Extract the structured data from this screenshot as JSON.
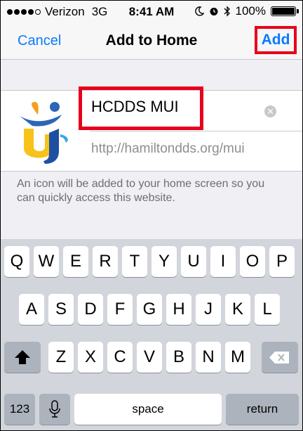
{
  "status_bar": {
    "carrier": "Verizon",
    "network": "3G",
    "time": "8:41 AM",
    "battery": "100%",
    "signal_bars_filled": 4,
    "signal_bars_total": 5,
    "battery_level": 1.0
  },
  "nav": {
    "cancel_label": "Cancel",
    "title": "Add to Home",
    "add_label": "Add"
  },
  "form": {
    "title_value": "HCDDS MUI",
    "url_value": "http://hamiltondds.org/mui",
    "note": "An icon will be added to your home screen so you can quickly access this website."
  },
  "keyboard": {
    "row1": [
      "Q",
      "W",
      "E",
      "R",
      "T",
      "Y",
      "U",
      "I",
      "O",
      "P"
    ],
    "row2": [
      "A",
      "S",
      "D",
      "F",
      "G",
      "H",
      "J",
      "K",
      "L"
    ],
    "row3": [
      "Z",
      "X",
      "C",
      "V",
      "B",
      "N",
      "M"
    ],
    "numbers_label": "123",
    "space_label": "space",
    "return_label": "return",
    "icons": [
      "shift-icon",
      "delete-icon",
      "microphone-icon"
    ]
  },
  "colors": {
    "accent": "#0a7aff",
    "highlight_box": "#e8001c",
    "keyboard_bg": "#d2d5db"
  }
}
